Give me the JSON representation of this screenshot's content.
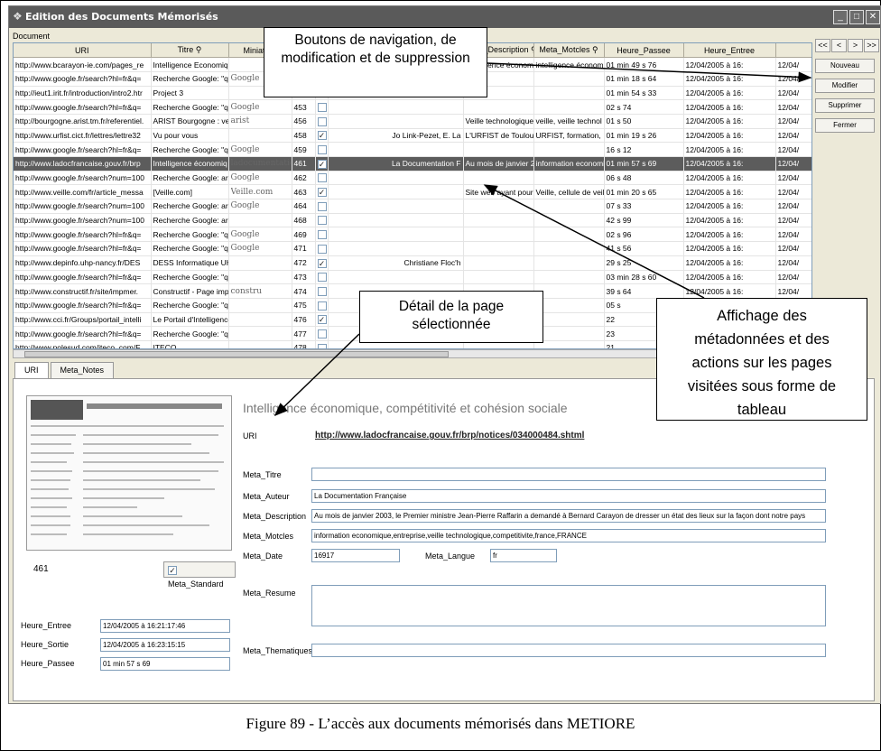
{
  "window": {
    "title": "Edition des Documents Mémorisés"
  },
  "grid": {
    "label": "Document",
    "columns": [
      "URI",
      "Titre",
      "Miniature",
      "",
      "",
      "",
      "Meta_Description",
      "Meta_Motcles",
      "Heure_Passee",
      "Heure_Entree",
      "He"
    ],
    "rows": [
      {
        "uri": "http://www.bcarayon-ie.com/pages_re",
        "titre": "Intelligence Economique",
        "thumb": "",
        "id": "",
        "checked": false,
        "auteur": "",
        "desc": "Intelligence économ",
        "mots": "intelligence économ",
        "passee": "01 min 49 s 76",
        "entree": "12/04/2005 à 16:",
        "he": "12/04/"
      },
      {
        "uri": "http://www.google.fr/search?hl=fr&q=",
        "titre": "Recherche Google: \"q",
        "thumb": "Google",
        "id": "",
        "checked": false,
        "auteur": "",
        "desc": "",
        "mots": "",
        "passee": "01 min 18 s 64",
        "entree": "12/04/2005 à 16:",
        "he": "12/04/"
      },
      {
        "uri": "http://ieut1.irit.fr/introduction/intro2.htr",
        "titre": "Project 3",
        "thumb": "",
        "id": "",
        "checked": false,
        "auteur": "",
        "desc": "",
        "mots": "",
        "passee": "01 min 54 s 33",
        "entree": "12/04/2005 à 16:",
        "he": "12/04/"
      },
      {
        "uri": "http://www.google.fr/search?hl=fr&q=",
        "titre": "Recherche Google: \"q",
        "thumb": "Google",
        "id": "453",
        "checked": false,
        "auteur": "",
        "desc": "",
        "mots": "",
        "passee": "02 s 74",
        "entree": "12/04/2005 à 16:",
        "he": "12/04/"
      },
      {
        "uri": "http://bourgogne.arist.tm.fr/referentiel.",
        "titre": "ARIST Bourgogne : ve",
        "thumb": "arist",
        "id": "456",
        "checked": false,
        "auteur": "",
        "desc": "Veille technologique",
        "mots": "veille, veille technol",
        "passee": "01 s 50",
        "entree": "12/04/2005 à 16:",
        "he": "12/04/"
      },
      {
        "uri": "http://www.urfist.cict.fr/lettres/lettre32",
        "titre": "Vu pour vous",
        "thumb": "",
        "id": "458",
        "checked": true,
        "auteur": "Jo Link-Pezet, E. La",
        "desc": "L'URFIST de Toulou",
        "mots": "URFIST, formation,",
        "passee": "01 min 19 s 26",
        "entree": "12/04/2005 à 16:",
        "he": "12/04/"
      },
      {
        "uri": "http://www.google.fr/search?hl=fr&q=",
        "titre": "Recherche Google: \"q",
        "thumb": "Google",
        "id": "459",
        "checked": false,
        "auteur": "",
        "desc": "",
        "mots": "",
        "passee": "16 s 12",
        "entree": "12/04/2005 à 16:",
        "he": "12/04/"
      },
      {
        "uri": "http://www.ladocfrancaise.gouv.fr/brp",
        "titre": "Intelligence économiq",
        "thumb": "ladocumentation",
        "id": "461",
        "checked": true,
        "auteur": "La Documentation F",
        "desc": "Au mois de janvier 2",
        "mots": "information economi",
        "passee": "01 min 57 s 69",
        "entree": "12/04/2005 à 16:",
        "he": "12/04/",
        "selected": true
      },
      {
        "uri": "http://www.google.fr/search?num=100",
        "titre": "Recherche Google: ar",
        "thumb": "Google",
        "id": "462",
        "checked": false,
        "auteur": "",
        "desc": "",
        "mots": "",
        "passee": "06 s 48",
        "entree": "12/04/2005 à 16:",
        "he": "12/04/"
      },
      {
        "uri": "http://www.veille.com/fr/article_messa",
        "titre": "[Veille.com]",
        "thumb": "Veille.com",
        "id": "463",
        "checked": true,
        "auteur": "",
        "desc": "Site web ayant pour",
        "mots": "Veille, cellule de veil",
        "passee": "01 min 20 s 65",
        "entree": "12/04/2005 à 16:",
        "he": "12/04/"
      },
      {
        "uri": "http://www.google.fr/search?num=100",
        "titre": "Recherche Google: ar",
        "thumb": "Google",
        "id": "464",
        "checked": false,
        "auteur": "",
        "desc": "",
        "mots": "",
        "passee": "07 s 33",
        "entree": "12/04/2005 à 16:",
        "he": "12/04/"
      },
      {
        "uri": "http://www.google.fr/search?num=100",
        "titre": "Recherche Google: ar",
        "thumb": "",
        "id": "468",
        "checked": false,
        "auteur": "",
        "desc": "",
        "mots": "",
        "passee": "42 s 99",
        "entree": "12/04/2005 à 16:",
        "he": "12/04/"
      },
      {
        "uri": "http://www.google.fr/search?hl=fr&q=",
        "titre": "Recherche Google: \"q",
        "thumb": "Google",
        "id": "469",
        "checked": false,
        "auteur": "",
        "desc": "",
        "mots": "",
        "passee": "02 s 96",
        "entree": "12/04/2005 à 16:",
        "he": "12/04/"
      },
      {
        "uri": "http://www.google.fr/search?hl=fr&q=",
        "titre": "Recherche Google: \"q",
        "thumb": "Google",
        "id": "471",
        "checked": false,
        "auteur": "",
        "desc": "",
        "mots": "",
        "passee": "41 s 56",
        "entree": "12/04/2005 à 16:",
        "he": "12/04/"
      },
      {
        "uri": "http://www.depinfo.uhp-nancy.fr/DES",
        "titre": "DESS Informatique UH",
        "thumb": "",
        "id": "472",
        "checked": true,
        "auteur": "Christiane Floc'h",
        "desc": "",
        "mots": "",
        "passee": "29 s 25",
        "entree": "12/04/2005 à 16:",
        "he": "12/04/"
      },
      {
        "uri": "http://www.google.fr/search?hl=fr&q=",
        "titre": "Recherche Google: \"q",
        "thumb": "",
        "id": "473",
        "checked": false,
        "auteur": "",
        "desc": "",
        "mots": "",
        "passee": "03 min 28 s 60",
        "entree": "12/04/2005 à 16:",
        "he": "12/04/"
      },
      {
        "uri": "http://www.constructif.fr/site/impmer.",
        "titre": "Constructif - Page impr",
        "thumb": "constru",
        "id": "474",
        "checked": false,
        "auteur": "",
        "desc": "",
        "mots": "",
        "passee": "39 s 64",
        "entree": "12/04/2005 à 16:",
        "he": "12/04/"
      },
      {
        "uri": "http://www.google.fr/search?hl=fr&q=",
        "titre": "Recherche Google: \"q",
        "thumb": "",
        "id": "475",
        "checked": false,
        "auteur": "",
        "desc": "",
        "mots": "",
        "passee": "05 s",
        "entree": "",
        "he": ""
      },
      {
        "uri": "http://www.cci.fr/Groups/portail_intelli",
        "titre": "Le Portail d'Intelligence",
        "thumb": "",
        "id": "476",
        "checked": true,
        "auteur": "",
        "desc": "",
        "mots": "",
        "passee": "22",
        "entree": "",
        "he": ""
      },
      {
        "uri": "http://www.google.fr/search?hl=fr&q=",
        "titre": "Recherche Google: \"q",
        "thumb": "",
        "id": "477",
        "checked": false,
        "auteur": "",
        "desc": "",
        "mots": "",
        "passee": "23",
        "entree": "",
        "he": ""
      },
      {
        "uri": "http://www.polesud.com/iteco_com/F",
        "titre": "ITECO",
        "thumb": "",
        "id": "478",
        "checked": false,
        "auteur": "",
        "desc": "",
        "mots": "",
        "passee": "21",
        "entree": "",
        "he": ""
      }
    ]
  },
  "nav": {
    "first": "<<",
    "prev": "<",
    "next": ">",
    "last": ">>"
  },
  "actions": {
    "new": "Nouveau",
    "edit": "Modifier",
    "delete": "Supprimer",
    "close": "Fermer"
  },
  "tabs": [
    "URI",
    "Meta_Notes"
  ],
  "detail": {
    "page_title": "Intelligence économique, compétitivité et cohésion sociale",
    "uri_label": "URI",
    "uri_value": "http://www.ladocfrancaise.gouv.fr/brp/notices/034000484.shtml",
    "titre_label": "Meta_Titre",
    "titre_value": "",
    "auteur_label": "Meta_Auteur",
    "auteur_value": "La Documentation Française",
    "desc_label": "Meta_Description",
    "desc_value": "Au mois de janvier 2003, le Premier ministre Jean-Pierre Raffarin a demandé à Bernard Carayon de dresser un état des lieux sur la façon dont notre pays",
    "motcles_label": "Meta_Motcles",
    "motcles_value": "information economique,entreprise,veille technologique,competitivite,france,FRANCE",
    "date_label": "Meta_Date",
    "date_value": "16917",
    "langue_label": "Meta_Langue",
    "langue_value": "fr",
    "resume_label": "Meta_Resume",
    "thematiques_label": "Meta_Thematiques",
    "id_value": "461",
    "standard_label": "Meta_Standard",
    "entree_label": "Heure_Entree",
    "entree_value": "12/04/2005 à 16:21:17:46",
    "sortie_label": "Heure_Sortie",
    "sortie_value": "12/04/2005 à 16:23:15:15",
    "passee_label": "Heure_Passee",
    "passee_value": "01 min 57 s 69"
  },
  "callouts": {
    "nav": "Boutons de navigation, de modification et de suppression",
    "detail": "Détail de la page sélectionnée",
    "meta": "Affichage des métadonnées et des actions sur les pages visitées sous forme de tableau"
  },
  "caption": "Figure 89 - L’accès aux documents mémorisés dans METIORE"
}
